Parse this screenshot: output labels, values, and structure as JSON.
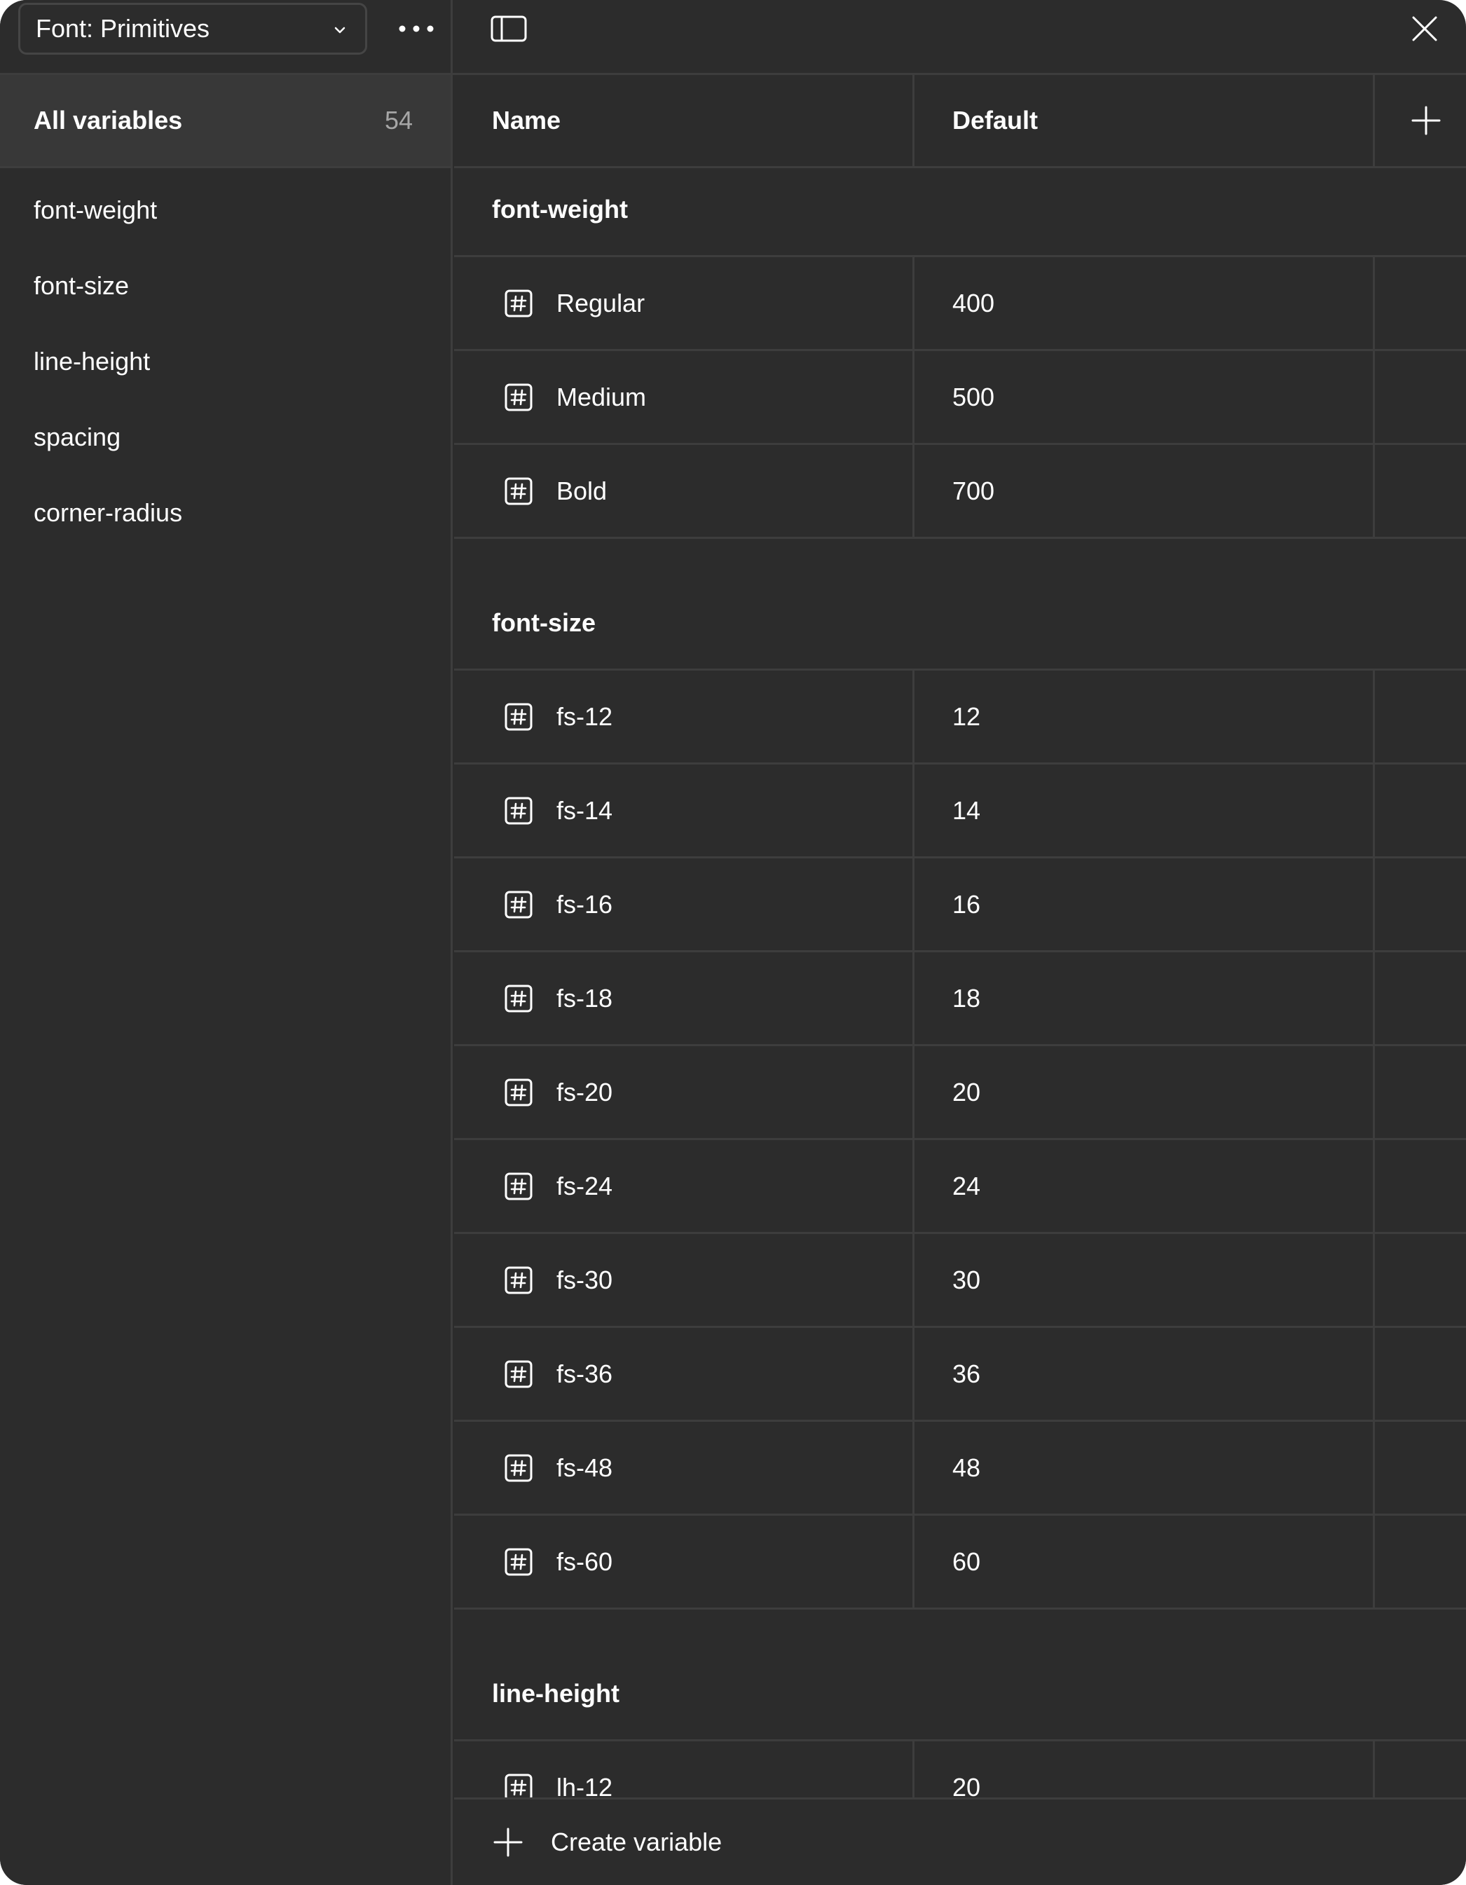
{
  "sidebar": {
    "collection": "Font: Primitives",
    "all_variables": {
      "label": "All variables",
      "count": "54"
    },
    "groups": [
      "font-weight",
      "font-size",
      "line-height",
      "spacing",
      "corner-radius"
    ]
  },
  "table": {
    "headers": {
      "name": "Name",
      "default": "Default"
    },
    "groups": [
      {
        "title": "font-weight",
        "rows": [
          {
            "name": "Regular",
            "value": "400"
          },
          {
            "name": "Medium",
            "value": "500"
          },
          {
            "name": "Bold",
            "value": "700"
          }
        ]
      },
      {
        "title": "font-size",
        "rows": [
          {
            "name": "fs-12",
            "value": "12"
          },
          {
            "name": "fs-14",
            "value": "14"
          },
          {
            "name": "fs-16",
            "value": "16"
          },
          {
            "name": "fs-18",
            "value": "18"
          },
          {
            "name": "fs-20",
            "value": "20"
          },
          {
            "name": "fs-24",
            "value": "24"
          },
          {
            "name": "fs-30",
            "value": "30"
          },
          {
            "name": "fs-36",
            "value": "36"
          },
          {
            "name": "fs-48",
            "value": "48"
          },
          {
            "name": "fs-60",
            "value": "60"
          }
        ]
      },
      {
        "title": "line-height",
        "rows": [
          {
            "name": "lh-12",
            "value": "20"
          }
        ]
      }
    ]
  },
  "footer": {
    "create_label": "Create variable"
  },
  "colors": {
    "background": "#2c2c2c",
    "selected": "#383838",
    "border": "#3d3d3d",
    "text": "#ffffff",
    "muted": "#a6a6a6"
  },
  "icons": [
    "chevron-down-icon",
    "more-icon",
    "sidebar-toggle-icon",
    "close-icon",
    "plus-icon",
    "number-variable-icon"
  ]
}
